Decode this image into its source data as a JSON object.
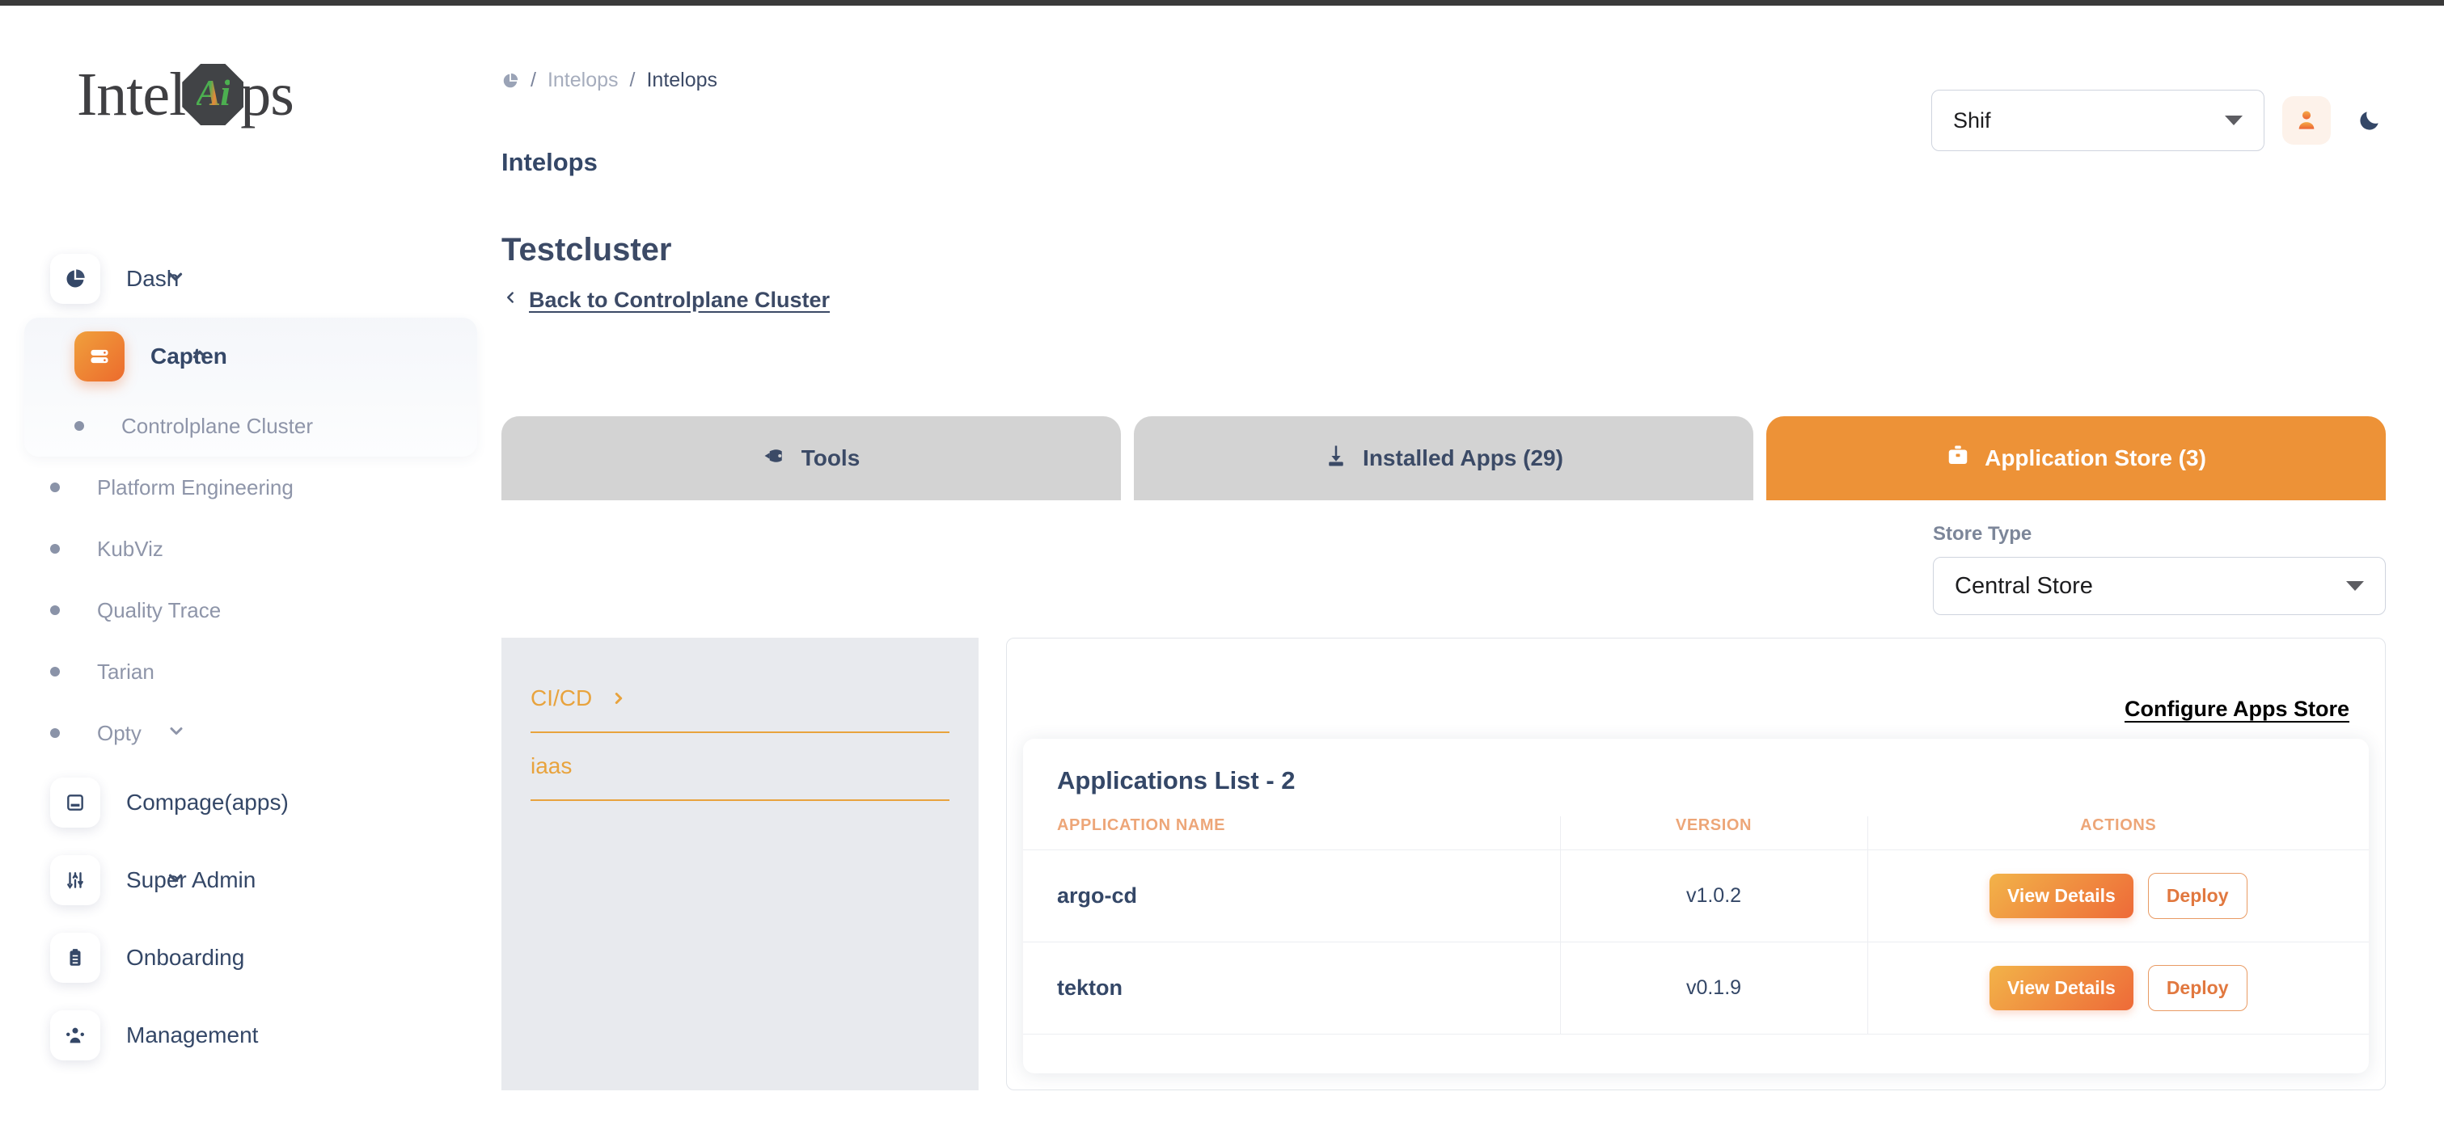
{
  "logo": {
    "part1": "Intel",
    "badge": "Ai",
    "part2": "ps"
  },
  "sidebar": {
    "items": [
      {
        "label": "Dash",
        "icon": "pie-chart-icon",
        "chevron": "down",
        "active": false
      },
      {
        "label": "Capten",
        "icon": "server-icon",
        "chevron": "up",
        "active": true
      },
      {
        "label": "Compage(apps)",
        "icon": "window-icon",
        "chevron": "",
        "active": false
      },
      {
        "label": "Super Admin",
        "icon": "sliders-icon",
        "chevron": "down",
        "active": false
      },
      {
        "label": "Onboarding",
        "icon": "clipboard-icon",
        "chevron": "",
        "active": false
      },
      {
        "label": "Management",
        "icon": "users-icon",
        "chevron": "",
        "active": false
      }
    ],
    "capten_children": [
      {
        "label": "Controlplane Cluster",
        "chevron": ""
      },
      {
        "label": "Platform Engineering",
        "chevron": ""
      },
      {
        "label": "KubViz",
        "chevron": ""
      },
      {
        "label": "Quality Trace",
        "chevron": ""
      },
      {
        "label": "Tarian",
        "chevron": ""
      },
      {
        "label": "Opty",
        "chevron": "down"
      }
    ]
  },
  "header": {
    "breadcrumb": {
      "home_icon": "pie-chart-icon",
      "sep": "/",
      "parent": "Intelops",
      "current": "Intelops"
    },
    "page_title": "Intelops",
    "org_select": {
      "value": "Shif"
    },
    "avatar_icon": "user-icon",
    "theme_icon": "moon-icon"
  },
  "cluster": {
    "title": "Testcluster",
    "back_link": "Back to Controlplane Cluster",
    "back_icon": "chevron-left-icon"
  },
  "tabs": [
    {
      "label": "Tools",
      "icon": "rocket-icon",
      "active": false
    },
    {
      "label": "Installed Apps (29)",
      "icon": "download-icon",
      "active": false
    },
    {
      "label": "Application Store (3)",
      "icon": "briefcase-icon",
      "active": true
    }
  ],
  "store_type": {
    "label": "Store Type",
    "value": "Central Store"
  },
  "categories": [
    {
      "label": "CI/CD",
      "chevron": "chevron-right-icon",
      "selected": true
    },
    {
      "label": "iaas",
      "chevron": "",
      "selected": false
    }
  ],
  "apps_panel": {
    "configure_link": "Configure Apps Store",
    "list_title": "Applications List - 2",
    "columns": [
      "APPLICATION NAME",
      "VERSION",
      "ACTIONS"
    ],
    "rows": [
      {
        "name": "argo-cd",
        "version": "v1.0.2",
        "view_label": "View Details",
        "deploy_label": "Deploy"
      },
      {
        "name": "tekton",
        "version": "v0.1.9",
        "view_label": "View Details",
        "deploy_label": "Deploy"
      }
    ]
  },
  "colors": {
    "accent_orange": "#ed9237",
    "gradient_start": "#f2b349",
    "gradient_end": "#ee6a38",
    "navy": "#344767",
    "category_orange": "#e8a33d",
    "column_header": "#eda678"
  }
}
